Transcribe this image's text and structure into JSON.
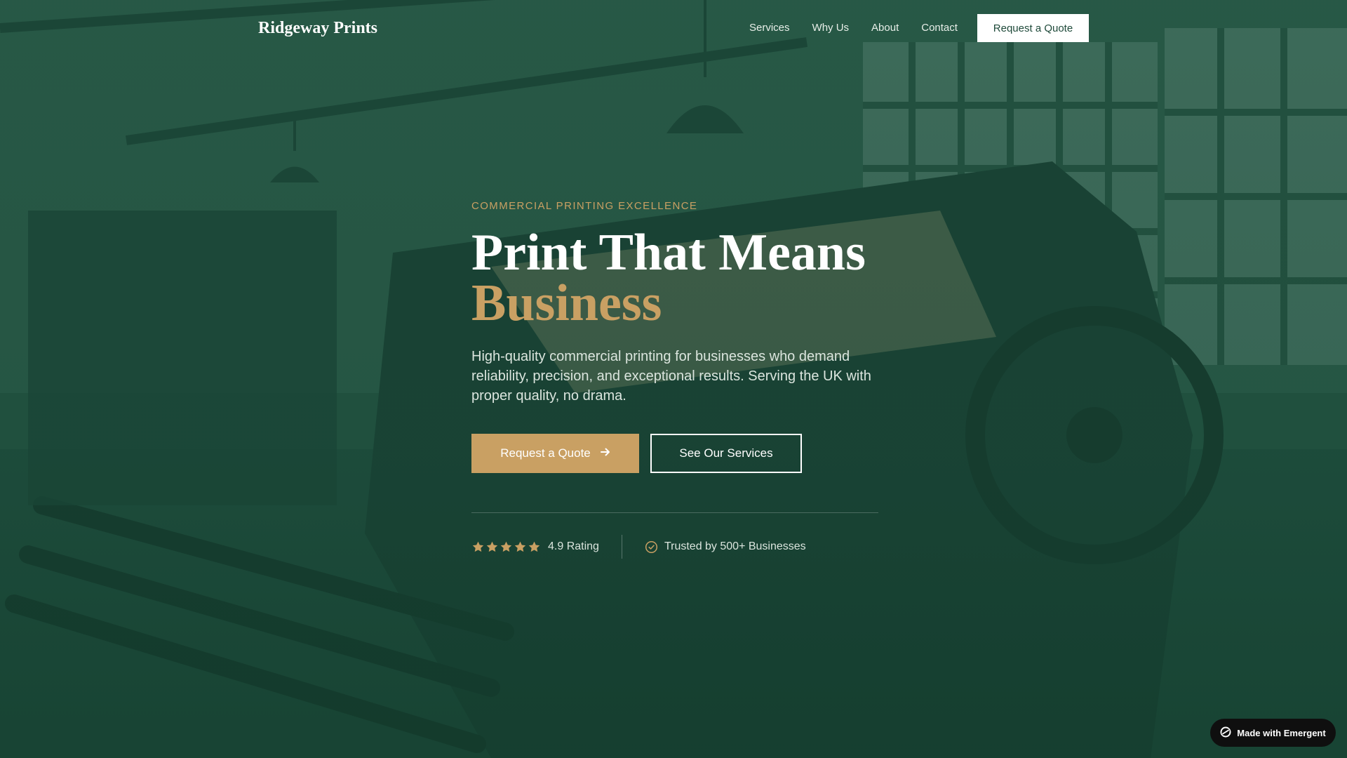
{
  "nav": {
    "brand": "Ridgeway Prints",
    "links": [
      {
        "label": "Services"
      },
      {
        "label": "Why Us"
      },
      {
        "label": "About"
      },
      {
        "label": "Contact"
      }
    ],
    "cta_label": "Request a Quote"
  },
  "hero": {
    "eyebrow": "COMMERCIAL PRINTING EXCELLENCE",
    "headline_line1": "Print That Means",
    "headline_accent": "Business",
    "subcopy": "High-quality commercial printing for businesses who demand reliability, precision, and exceptional results. Serving the UK with proper quality, no drama.",
    "primary_cta": "Request a Quote",
    "secondary_cta": "See Our Services"
  },
  "trust": {
    "rating_text": "4.9 Rating",
    "stars": 5,
    "trusted_text": "Trusted by 500+ Businesses"
  },
  "badge": {
    "label": "Made with Emergent"
  },
  "colors": {
    "brand_green": "#1f4a3a",
    "accent_gold": "#c9a063",
    "white": "#ffffff",
    "badge_black": "#0f0f0f"
  },
  "icons": {
    "primary_cta_icon": "arrow-right-icon",
    "rating_icon": "star-icon",
    "trusted_icon": "check-circle-icon",
    "badge_icon": "emergent-logo-icon"
  }
}
